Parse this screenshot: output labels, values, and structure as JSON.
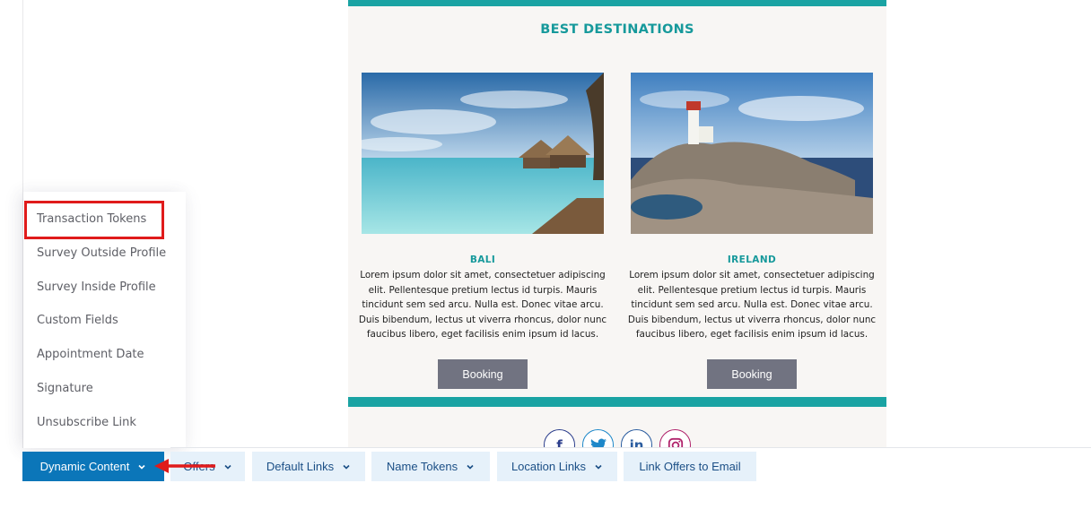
{
  "email": {
    "title": "BEST DESTINATIONS",
    "destinations": [
      {
        "name": "BALI",
        "text": "Lorem ipsum dolor sit amet, consectetuer adipiscing elit. Pellentesque pretium lectus id turpis. Mauris tincidunt sem sed arcu. Nulla est. Donec vitae arcu. Duis bibendum, lectus ut viverra rhoncus, dolor nunc faucibus libero, eget facilisis enim ipsum id lacus.",
        "button": "Booking"
      },
      {
        "name": "IRELAND",
        "text": "Lorem ipsum dolor sit amet, consectetuer adipiscing elit. Pellentesque pretium lectus id turpis. Mauris tincidunt sem sed arcu. Nulla est. Donec vitae arcu. Duis bibendum, lectus ut viverra rhoncus, dolor nunc faucibus libero, eget facilisis enim ipsum id lacus.",
        "button": "Booking"
      }
    ],
    "social": {
      "facebook_glyph": "f",
      "linkedin_glyph": "in"
    }
  },
  "menu": {
    "items": [
      "Transaction Tokens",
      "Survey Outside Profile",
      "Survey Inside Profile",
      "Custom Fields",
      "Appointment Date",
      "Signature",
      "Unsubscribe Link"
    ]
  },
  "toolbar": {
    "dynamic_content": "Dynamic Content",
    "offers": "Offers",
    "default_links": "Default Links",
    "name_tokens": "Name Tokens",
    "location_links": "Location Links",
    "link_offers": "Link Offers to Email"
  },
  "colors": {
    "teal": "#1aa3a3",
    "primary_button": "#0b76b9",
    "highlight_red": "#e01b1b"
  }
}
